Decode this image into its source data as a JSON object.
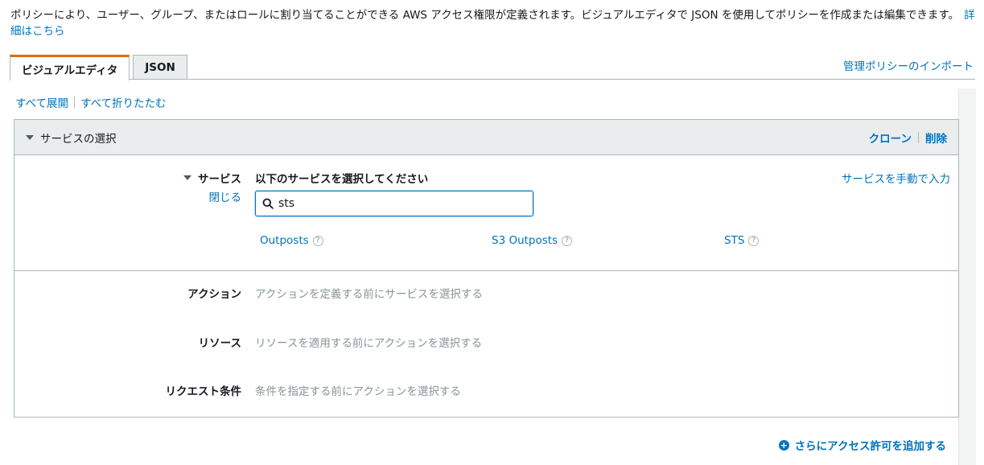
{
  "intro": {
    "text": "ポリシーにより、ユーザー、グループ、またはロールに割り当てることができる AWS アクセス権限が定義されます。ビジュアルエディタで JSON を使用してポリシーを作成または編集できます。",
    "link": "詳細はこちら"
  },
  "tabs": [
    {
      "label": "ビジュアルエディタ",
      "active": true
    },
    {
      "label": "JSON",
      "active": false
    }
  ],
  "import_link": "管理ポリシーのインポート",
  "expand_all": "すべて展開",
  "collapse_all": "すべて折りたたむ",
  "panel": {
    "title": "サービスの選択",
    "clone": "クローン",
    "delete": "削除",
    "service": {
      "label": "サービス",
      "close": "閉じる",
      "prompt": "以下のサービスを選択してください",
      "manual": "サービスを手動で入力",
      "search_value": "sts",
      "results": [
        "Outposts",
        "S3 Outposts",
        "STS"
      ]
    },
    "actions": {
      "label": "アクション",
      "hint": "アクションを定義する前にサービスを選択する"
    },
    "resources": {
      "label": "リソース",
      "hint": "リソースを適用する前にアクションを選択する"
    },
    "conditions": {
      "label": "リクエスト条件",
      "hint": "条件を指定する前にアクションを選択する"
    }
  },
  "add_permission": "さらにアクセス許可を追加する",
  "colors": {
    "link": "#0073bb",
    "tab_accent": "#dd6b10",
    "border": "#aab7b8"
  }
}
